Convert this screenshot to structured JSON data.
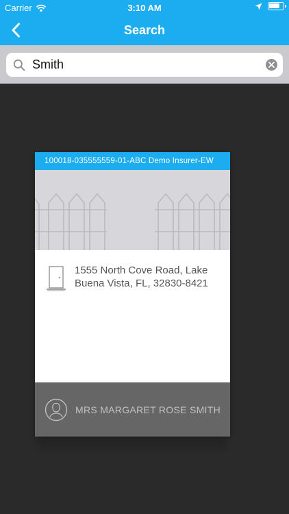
{
  "status_bar": {
    "carrier": "Carrier",
    "time": "3:10 AM"
  },
  "nav": {
    "title": "Search",
    "back_icon": "chevron-left-icon"
  },
  "search": {
    "value": "Smith",
    "icon": "search-icon",
    "clear_icon": "clear-icon"
  },
  "result_card": {
    "header": "100018-035555559-01-ABC Demo Insurer-EW",
    "image": "picket-fence-icon",
    "address_line1": "1555 North Cove Road, Lake",
    "address_line2": "Buena Vista, FL, 32830-8421",
    "address_icon": "door-icon",
    "owner_name": "MRS MARGARET ROSE SMITH",
    "owner_icon": "person-icon"
  },
  "colors": {
    "header_blue": "#1badf0",
    "background": "#2a2a2a",
    "search_bar": "#c9c9ce",
    "card_footer": "#666666",
    "image_gray": "#d7d7db"
  }
}
